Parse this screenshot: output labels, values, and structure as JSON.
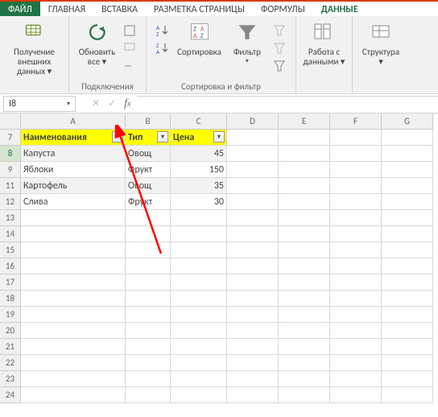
{
  "tabs": {
    "file": "ФАЙЛ",
    "home": "ГЛАВНАЯ",
    "insert": "ВСТАВКА",
    "pagelayout": "РАЗМЕТКА СТРАНИЦЫ",
    "formulas": "ФОРМУЛЫ",
    "data": "ДАННЫЕ"
  },
  "ribbon": {
    "get_ext": "Получение\nвнешних данных ▾",
    "refresh": "Обновить\nвсе ▾",
    "connections_group": "Подключения",
    "sort_asc": "A↓Z",
    "sort_desc": "Z↓A",
    "sort": "Сортировка",
    "filter": "Фильтр",
    "sortfilter_group": "Сортировка и фильтр",
    "data_tools": "Работа с\nданными ▾",
    "outline": "Структура\n▾"
  },
  "namebox": "I8",
  "columns": [
    "A",
    "B",
    "C",
    "D",
    "E",
    "F",
    "G"
  ],
  "headers": {
    "A": "Наименования",
    "B": "Тип",
    "C": "Цена"
  },
  "rows": [
    {
      "n": 8,
      "sel": true,
      "shaded": true,
      "A": "Капуста",
      "B": "Овощ",
      "C": "45"
    },
    {
      "n": 9,
      "sel": false,
      "shaded": false,
      "A": "Яблоки",
      "B": "Фрукт",
      "C": "150"
    },
    {
      "n": 11,
      "sel": false,
      "shaded": true,
      "A": "Картофель",
      "B": "Овощ",
      "C": "35"
    },
    {
      "n": 12,
      "sel": false,
      "shaded": false,
      "A": "Слива",
      "B": "Фрукт",
      "C": "30"
    }
  ],
  "empty_rows": [
    13,
    14,
    15,
    16,
    17,
    18,
    19,
    20,
    21,
    22,
    23,
    24
  ]
}
